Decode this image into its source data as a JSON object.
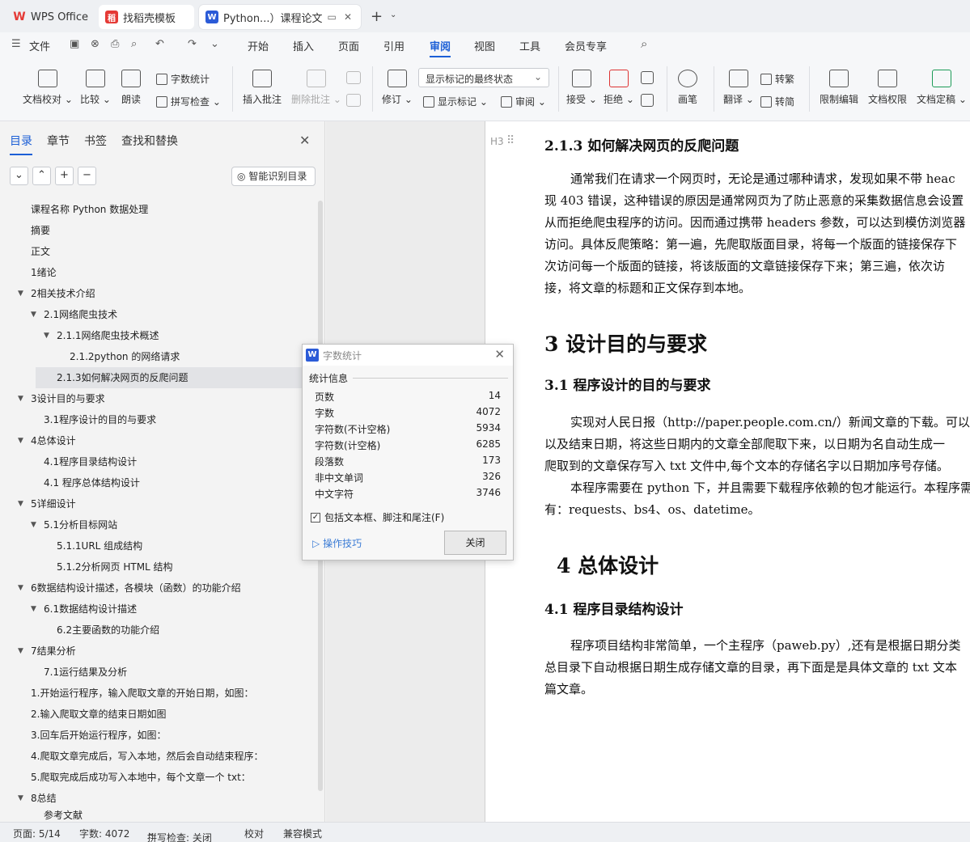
{
  "tabs": [
    {
      "label": "WPS Office"
    },
    {
      "label": "找稻壳模板"
    },
    {
      "label": "Python...）课程论文"
    }
  ],
  "menubar": {
    "file": "文件",
    "items": [
      "开始",
      "插入",
      "页面",
      "引用",
      "审阅",
      "视图",
      "工具",
      "会员专享"
    ],
    "active": "审阅"
  },
  "ribbon": {
    "doc_check": "文档校对",
    "compare": "比较",
    "read_aloud": "朗读",
    "word_count": "字数统计",
    "spell_check": "拼写检查",
    "insert_comment": "插入批注",
    "delete_comment": "删除批注",
    "track_changes": "修订",
    "markup_state": "显示标记的最终状态",
    "show_markup": "显示标记",
    "review_pane": "审阅",
    "accept": "接受",
    "reject": "拒绝",
    "pen": "画笔",
    "translate": "翻译",
    "to_traditional": "转繁",
    "to_simplified": "转简",
    "restrict_edit": "限制编辑",
    "doc_permission": "文档权限",
    "doc_finalize": "文档定稿"
  },
  "nav": {
    "tabs": [
      "目录",
      "章节",
      "书签",
      "查找和替换"
    ],
    "smart_toc": "智能识别目录",
    "toc": [
      {
        "label": "课程名称   Python 数据处理"
      },
      {
        "label": "摘要"
      },
      {
        "label": "正文"
      },
      {
        "label": "1绪论"
      },
      {
        "label": "2相关技术介绍"
      },
      {
        "label": "2.1网络爬虫技术"
      },
      {
        "label": "2.1.1网络爬虫技术概述"
      },
      {
        "label": "2.1.2python 的网络请求"
      },
      {
        "label": "2.1.3如何解决网页的反爬问题"
      },
      {
        "label": "3设计目的与要求"
      },
      {
        "label": "3.1程序设计的目的与要求"
      },
      {
        "label": "4总体设计"
      },
      {
        "label": "4.1程序目录结构设计"
      },
      {
        "label": "4.1 程序总体结构设计"
      },
      {
        "label": "5详细设计"
      },
      {
        "label": "5.1分析目标网站"
      },
      {
        "label": "5.1.1URL 组成结构"
      },
      {
        "label": "5.1.2分析网页 HTML 结构"
      },
      {
        "label": "6数据结构设计描述，各模块（函数）的功能介绍"
      },
      {
        "label": "6.1数据结构设计描述"
      },
      {
        "label": "6.2主要函数的功能介绍"
      },
      {
        "label": "7结果分析"
      },
      {
        "label": "7.1运行结果及分析"
      },
      {
        "label": "1.开始运行程序，输入爬取文章的开始日期，如图："
      },
      {
        "label": "2.输入爬取文章的结束日期如图"
      },
      {
        "label": "3.回车后开始运行程序，如图："
      },
      {
        "label": "4.爬取文章完成后，写入本地，然后会自动结束程序："
      },
      {
        "label": "5.爬取完成后成功写入本地中，每个文章一个 txt："
      },
      {
        "label": "8总结"
      },
      {
        "label": "参考文献"
      }
    ]
  },
  "document": {
    "heading_marker": "H3",
    "h_213": "2.1.3 如何解决网页的反爬问题",
    "p1": [
      "通常我们在请求一个网页时，无论是通过哪种请求，发现如果不带 heac",
      "现 403 错误，这种错误的原因是通常网页为了防止恶意的采集数据信息会设置",
      "从而拒绝爬虫程序的访问。因而通过携带 headers 参数，可以达到模仿浏览器",
      "访问。具体反爬策略：第一遍，先爬取版面目录，将每一个版面的链接保存下",
      "次访问每一个版面的链接，将该版面的文章链接保存下来；第三遍，依次访",
      "接，将文章的标题和正文保存到本地。"
    ],
    "h_3": "3 设计目的与要求",
    "h_31": "3.1  程序设计的目的与要求",
    "p2": [
      "实现对人民日报（http://paper.people.com.cn/）新闻文章的下载。可以输",
      "以及结束日期，将这些日期内的文章全部爬取下来，以日期为名自动生成一",
      "爬取到的文章保存写入 txt 文件中,每个文本的存储名字以日期加序号存储。"
    ],
    "p3": [
      "本程序需要在 python 下，并且需要下载程序依赖的包才能运行。本程序需",
      "有：requests、bs4、os、datetime。"
    ],
    "h_4": "4 总体设计",
    "h_41": "4.1  程序目录结构设计",
    "p4": [
      "程序项目结构非常简单，一个主程序（paweb.py）,还有是根据日期分类",
      "总目录下自动根据日期生成存储文章的目录，再下面是是具体文章的 txt 文本",
      "篇文章。"
    ]
  },
  "dialog": {
    "title": "字数统计",
    "section": "统计信息",
    "stats": [
      {
        "label": "页数",
        "value": "14"
      },
      {
        "label": "字数",
        "value": "4072"
      },
      {
        "label": "字符数(不计空格)",
        "value": "5934"
      },
      {
        "label": "字符数(计空格)",
        "value": "6285"
      },
      {
        "label": "段落数",
        "value": "173"
      },
      {
        "label": "非中文单词",
        "value": "326"
      },
      {
        "label": "中文字符",
        "value": "3746"
      }
    ],
    "include_label": "包括文本框、脚注和尾注(F)",
    "include_checked": true,
    "tips": "操作技巧",
    "close": "关闭"
  },
  "status": {
    "page": "页面: 5/14",
    "words": "字数: 4072",
    "spell": "拼写检查: 关闭",
    "proof": "校对",
    "compat": "兼容模式"
  },
  "colors": {
    "accent": "#1c5fd6",
    "wps_red": "#e53935",
    "doc_blue": "#2b5bd7"
  }
}
